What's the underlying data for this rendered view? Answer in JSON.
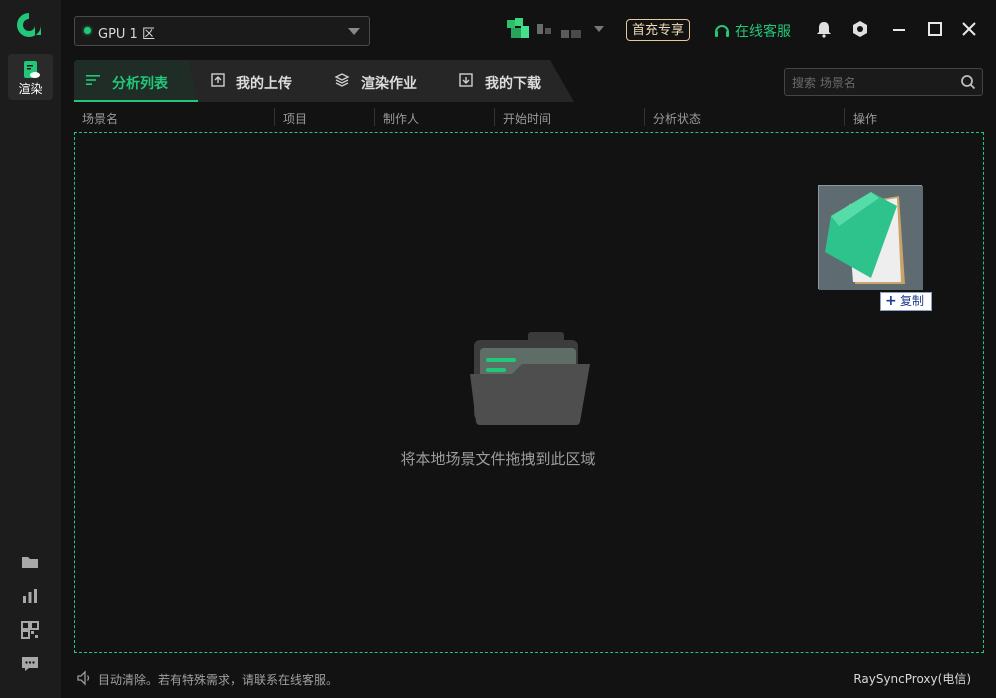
{
  "sidebar": {
    "nav_render_label": "渲染"
  },
  "header": {
    "gpu_region": "GPU 1 区",
    "vip_badge": "首充专享",
    "support_label": "在线客服"
  },
  "tabs": [
    {
      "label": "分析列表",
      "active": true
    },
    {
      "label": "我的上传",
      "active": false
    },
    {
      "label": "渲染作业",
      "active": false
    },
    {
      "label": "我的下载",
      "active": false
    }
  ],
  "search": {
    "placeholder": "搜索 场景名"
  },
  "table": {
    "columns": [
      "场景名",
      "项目",
      "制作人",
      "开始时间",
      "分析状态",
      "操作"
    ]
  },
  "dropzone": {
    "hint": "将本地场景文件拖拽到此区域"
  },
  "drag": {
    "copy_label": "复制"
  },
  "statusbar": {
    "message": "目动清除。若有特殊需求，请联系在线客服。",
    "proxy": "RaySyncProxy(电信)"
  },
  "colors": {
    "accent": "#22c77a",
    "vip": "#e6c99a",
    "background": "#121212",
    "sidebar": "#1c1c1c"
  }
}
